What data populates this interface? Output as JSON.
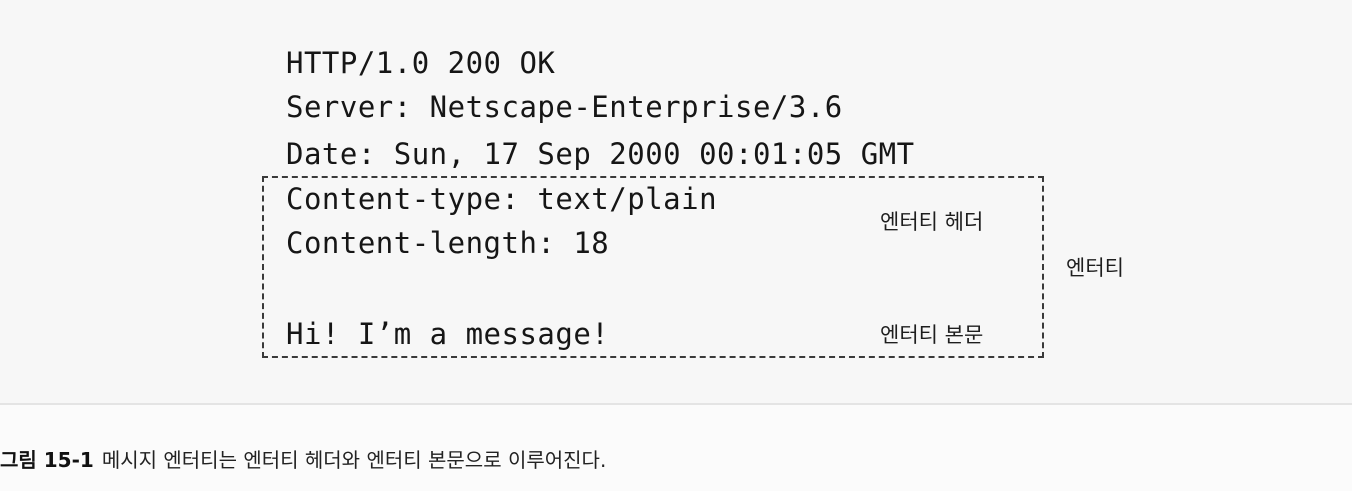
{
  "http_message": {
    "lines": [
      "HTTP/1.0 200 OK",
      "Server: Netscape-Enterprise/3.6",
      "Date: Sun, 17 Sep 2000 00:01:05 GMT",
      "Content-type: text/plain",
      "Content-length: 18",
      "Hi! I’m a message!"
    ]
  },
  "labels": {
    "entity_header": "엔터티 헤더",
    "entity": "엔터티",
    "entity_body": "엔터티 본문"
  },
  "caption": {
    "figure_number": "그림 15-1",
    "text": "메시지 엔터티는 엔터티 헤더와 엔터티 본문으로 이루어진다."
  }
}
